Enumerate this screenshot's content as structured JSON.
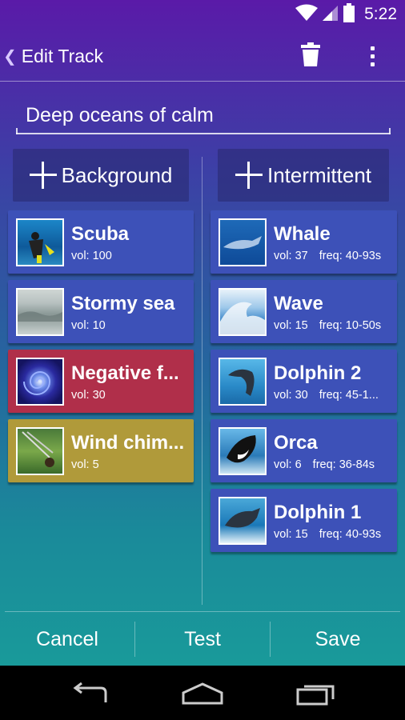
{
  "status_bar": {
    "time": "5:22",
    "icons": [
      "wifi-icon",
      "cell-signal-icon",
      "battery-icon"
    ]
  },
  "action_bar": {
    "title": "Edit Track",
    "icons": [
      "back-chevron-icon",
      "trash-icon",
      "overflow-menu-icon"
    ]
  },
  "track": {
    "name": "Deep oceans of calm"
  },
  "background_column": {
    "add_label": "Background",
    "items": [
      {
        "name": "Scuba",
        "vol": "vol: 100",
        "color": "#3d51b8",
        "thumb": "scuba-diver-thumbnail"
      },
      {
        "name": "Stormy sea",
        "vol": "vol: 10",
        "color": "#3d51b8",
        "thumb": "stormy-sea-thumbnail"
      },
      {
        "name": "Negative f...",
        "vol": "vol: 30",
        "color": "#b02f4a",
        "thumb": "spiral-galaxy-thumbnail"
      },
      {
        "name": "Wind chim...",
        "vol": "vol: 5",
        "color": "#b09a3a",
        "thumb": "wind-chime-thumbnail"
      }
    ]
  },
  "intermittent_column": {
    "add_label": "Intermittent",
    "items": [
      {
        "name": "Whale",
        "vol": "vol: 37",
        "freq": "freq: 40-93s",
        "color": "#3d51b8",
        "thumb": "whale-thumbnail"
      },
      {
        "name": "Wave",
        "vol": "vol: 15",
        "freq": "freq: 10-50s",
        "color": "#3d51b8",
        "thumb": "wave-thumbnail"
      },
      {
        "name": "Dolphin 2",
        "vol": "vol: 30",
        "freq": "freq: 45-1...",
        "color": "#3d51b8",
        "thumb": "dolphin-thumbnail"
      },
      {
        "name": "Orca",
        "vol": "vol: 6",
        "freq": "freq: 36-84s",
        "color": "#3d51b8",
        "thumb": "orca-thumbnail"
      },
      {
        "name": "Dolphin 1",
        "vol": "vol: 15",
        "freq": "freq: 40-93s",
        "color": "#3d51b8",
        "thumb": "dolphin-thumbnail"
      }
    ]
  },
  "bottom_bar": {
    "cancel": "Cancel",
    "test": "Test",
    "save": "Save"
  },
  "nav_bar": {
    "icons": [
      "back-arrow-icon",
      "home-icon",
      "recent-apps-icon"
    ]
  }
}
